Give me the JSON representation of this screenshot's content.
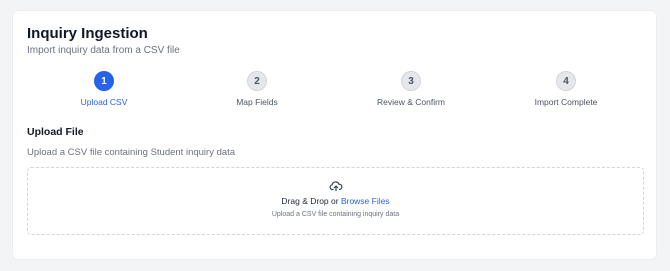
{
  "header": {
    "title": "Inquiry Ingestion",
    "subtitle": "Import inquiry data from a CSV file"
  },
  "steps": [
    {
      "number": "1",
      "label": "Upload CSV",
      "active": true
    },
    {
      "number": "2",
      "label": "Map Fields",
      "active": false
    },
    {
      "number": "3",
      "label": "Review & Confirm",
      "active": false
    },
    {
      "number": "4",
      "label": "Import Complete",
      "active": false
    }
  ],
  "upload": {
    "title": "Upload File",
    "description": "Upload a CSV file containing Student inquiry data",
    "drag_text": "Drag & Drop or ",
    "browse_text": "Browse Files",
    "hint": "Upload a CSV file containing inquiry data",
    "icon": "cloud-upload-icon"
  },
  "colors": {
    "accent": "#2563eb",
    "background": "#f3f4f6",
    "card": "#ffffff"
  }
}
